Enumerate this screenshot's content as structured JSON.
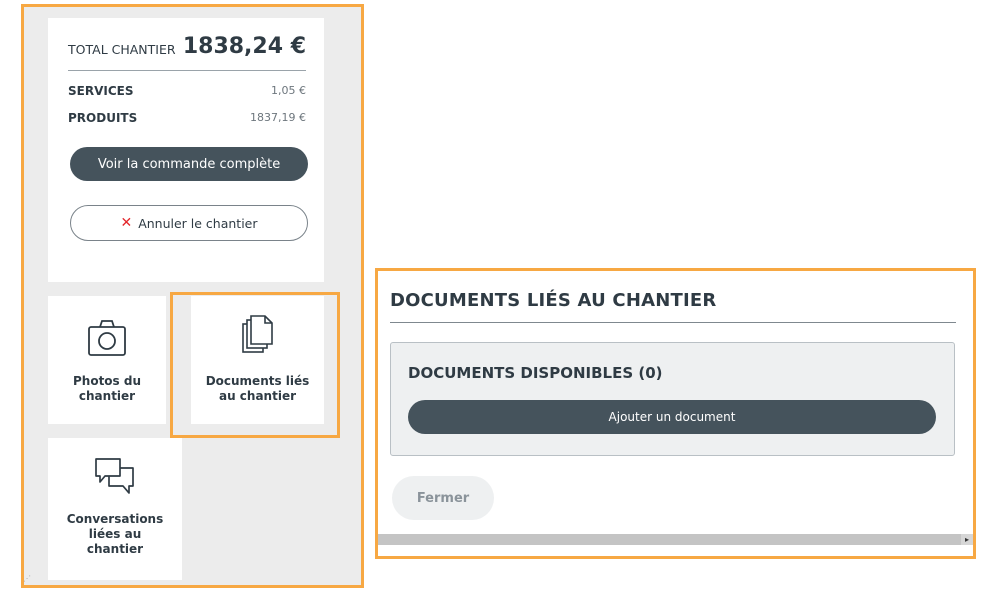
{
  "summary": {
    "total_label": "TOTAL CHANTIER",
    "total_value": "1838,24 €",
    "services_label": "SERVICES",
    "services_value": "1,05 €",
    "produits_label": "PRODUITS",
    "produits_value": "1837,19 €",
    "view_order_label": "Voir la commande complète",
    "cancel_label": "Annuler le chantier",
    "cancel_icon": "close-icon"
  },
  "tiles": {
    "photos": {
      "label_line1": "Photos du",
      "label_line2": "chantier",
      "icon": "camera-icon"
    },
    "documents": {
      "label_line1": "Documents liés",
      "label_line2": "au chantier",
      "icon": "documents-icon"
    },
    "conversations": {
      "label_line1": "Conversations",
      "label_line2": "liées au",
      "label_line3": "chantier",
      "icon": "chat-icon"
    }
  },
  "documents_panel": {
    "title": "DOCUMENTS LIÉS AU CHANTIER",
    "available_title": "DOCUMENTS DISPONIBLES (0)",
    "add_label": "Ajouter un document",
    "close_label": "Fermer"
  },
  "colors": {
    "accent_highlight": "#f7a843",
    "button_dark": "#45535c",
    "danger": "#e3262b"
  }
}
